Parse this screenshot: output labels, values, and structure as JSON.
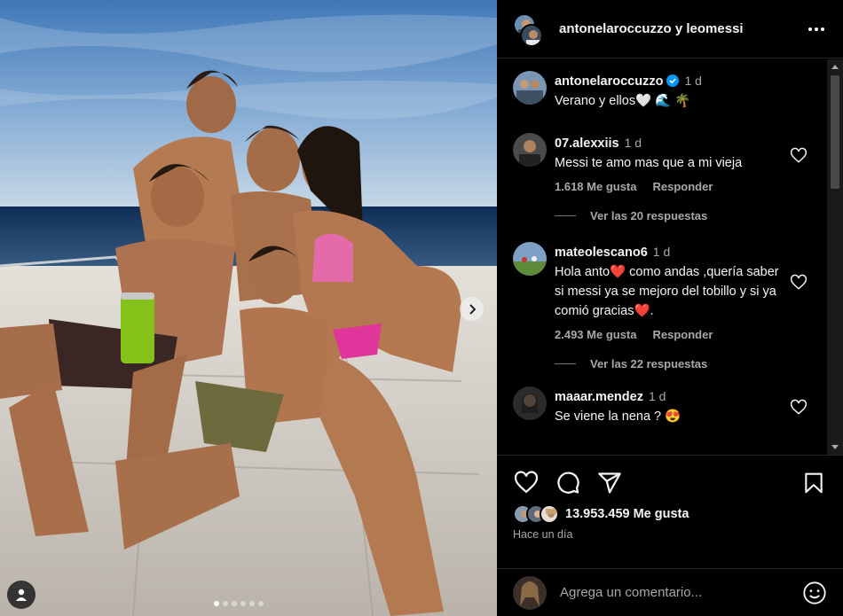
{
  "post": {
    "photo_alt": "",
    "can_text": "",
    "carousel_dots": 6,
    "carousel_active": 0
  },
  "header": {
    "user1": "antonelaroccuzzo",
    "connector": "y",
    "user2": "leomessi"
  },
  "caption": {
    "user": "antonelaroccuzzo",
    "time": "1 d",
    "text": "Verano y ellos🤍 🌊 🌴"
  },
  "comments": [
    {
      "user": "07.alexxiis",
      "time": "1 d",
      "text": "Messi te amo mas que a mi vieja",
      "likes": "1.618 Me gusta",
      "reply": "Responder",
      "replies": "Ver las 20 respuestas"
    },
    {
      "user": "mateolescano6",
      "time": "1 d",
      "text": "Hola anto❤️  como andas ,quería saber si messi ya se mejoro del tobillo y si ya comió gracias❤️.",
      "likes": "2.493 Me gusta",
      "reply": "Responder",
      "replies": "Ver las 22 respuestas"
    },
    {
      "user": "maaar.mendez",
      "time": "1 d",
      "text": "Se viene la nena ? 😍"
    }
  ],
  "likes": {
    "count_text": "13.953.459 Me gusta",
    "time_ago": "Hace un día"
  },
  "composer": {
    "placeholder": "Agrega un comentario..."
  },
  "icons": [
    "heart-icon",
    "comment-icon",
    "share-icon",
    "bookmark-icon",
    "more-icon",
    "emoji-icon",
    "user-tag-icon",
    "chevron-right-icon",
    "verified-icon"
  ],
  "colors": {
    "background": "#000000",
    "text": "#f5f5f5",
    "muted": "#a8a8a8",
    "divider": "#262626",
    "verified": "#0095f6"
  }
}
